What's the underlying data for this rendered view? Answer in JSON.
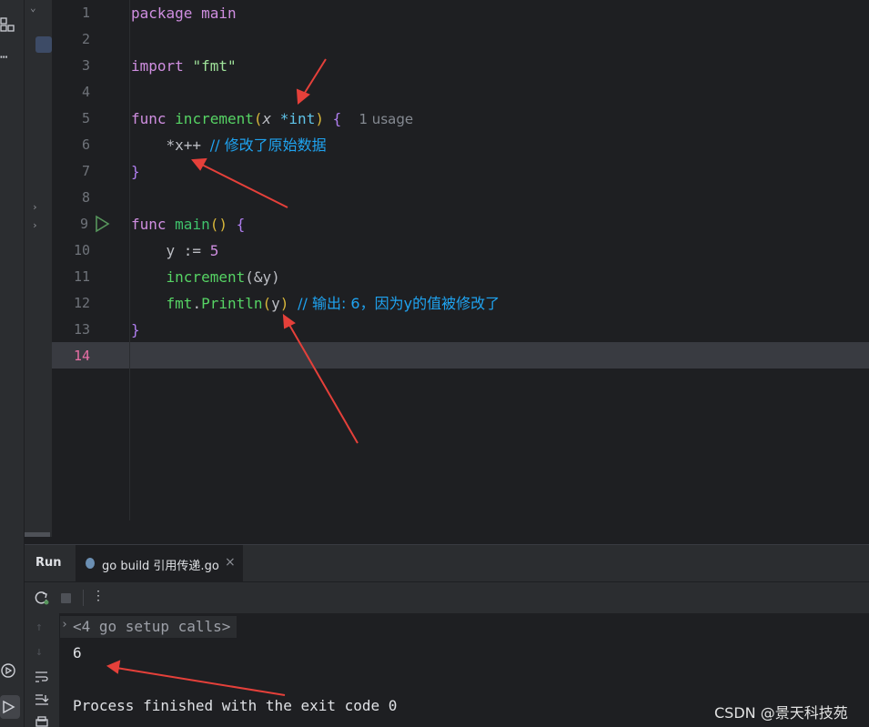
{
  "editor": {
    "lines": [
      {
        "num": "1"
      },
      {
        "num": "2"
      },
      {
        "num": "3"
      },
      {
        "num": "4"
      },
      {
        "num": "5"
      },
      {
        "num": "6"
      },
      {
        "num": "7"
      },
      {
        "num": "8"
      },
      {
        "num": "9"
      },
      {
        "num": "10"
      },
      {
        "num": "11"
      },
      {
        "num": "12"
      },
      {
        "num": "13"
      },
      {
        "num": "14"
      }
    ],
    "tokens": {
      "package_kw": "package",
      "main_name": "main",
      "import_kw": "import",
      "import_str": "\"fmt\"",
      "func_kw": "func",
      "increment_name": "increment",
      "lparen": "(",
      "param_x": "x",
      "star_int": " *int",
      "rparen": ")",
      "lbrace": " {",
      "usage_hint": "1 usage",
      "deref_inc": "*x++ ",
      "comment1": "// 修改了原始数据",
      "rbrace": "}",
      "main_fn": "main",
      "main_parens": "()",
      "y_assign": "y := ",
      "five": "5",
      "increment_call": "increment",
      "call_args": "(&y)",
      "fmt_pkg": "fmt",
      "dot": ".",
      "println": "Println",
      "y_arg": "y",
      "comment2": "// 输出: 6，因为y的值被修改了"
    }
  },
  "run_panel": {
    "run_label": "Run",
    "tab_label": "go build 引用传递.go",
    "close_symbol": "×",
    "setup_calls": "<4 go setup calls>",
    "output_value": "6",
    "exit_message": "Process finished with the exit code 0"
  },
  "watermark": "CSDN @景天科技苑",
  "colors": {
    "accent": "#e5403a",
    "keyword": "#cf8ee0",
    "function": "#56d364",
    "comment": "#1fa3f0"
  }
}
